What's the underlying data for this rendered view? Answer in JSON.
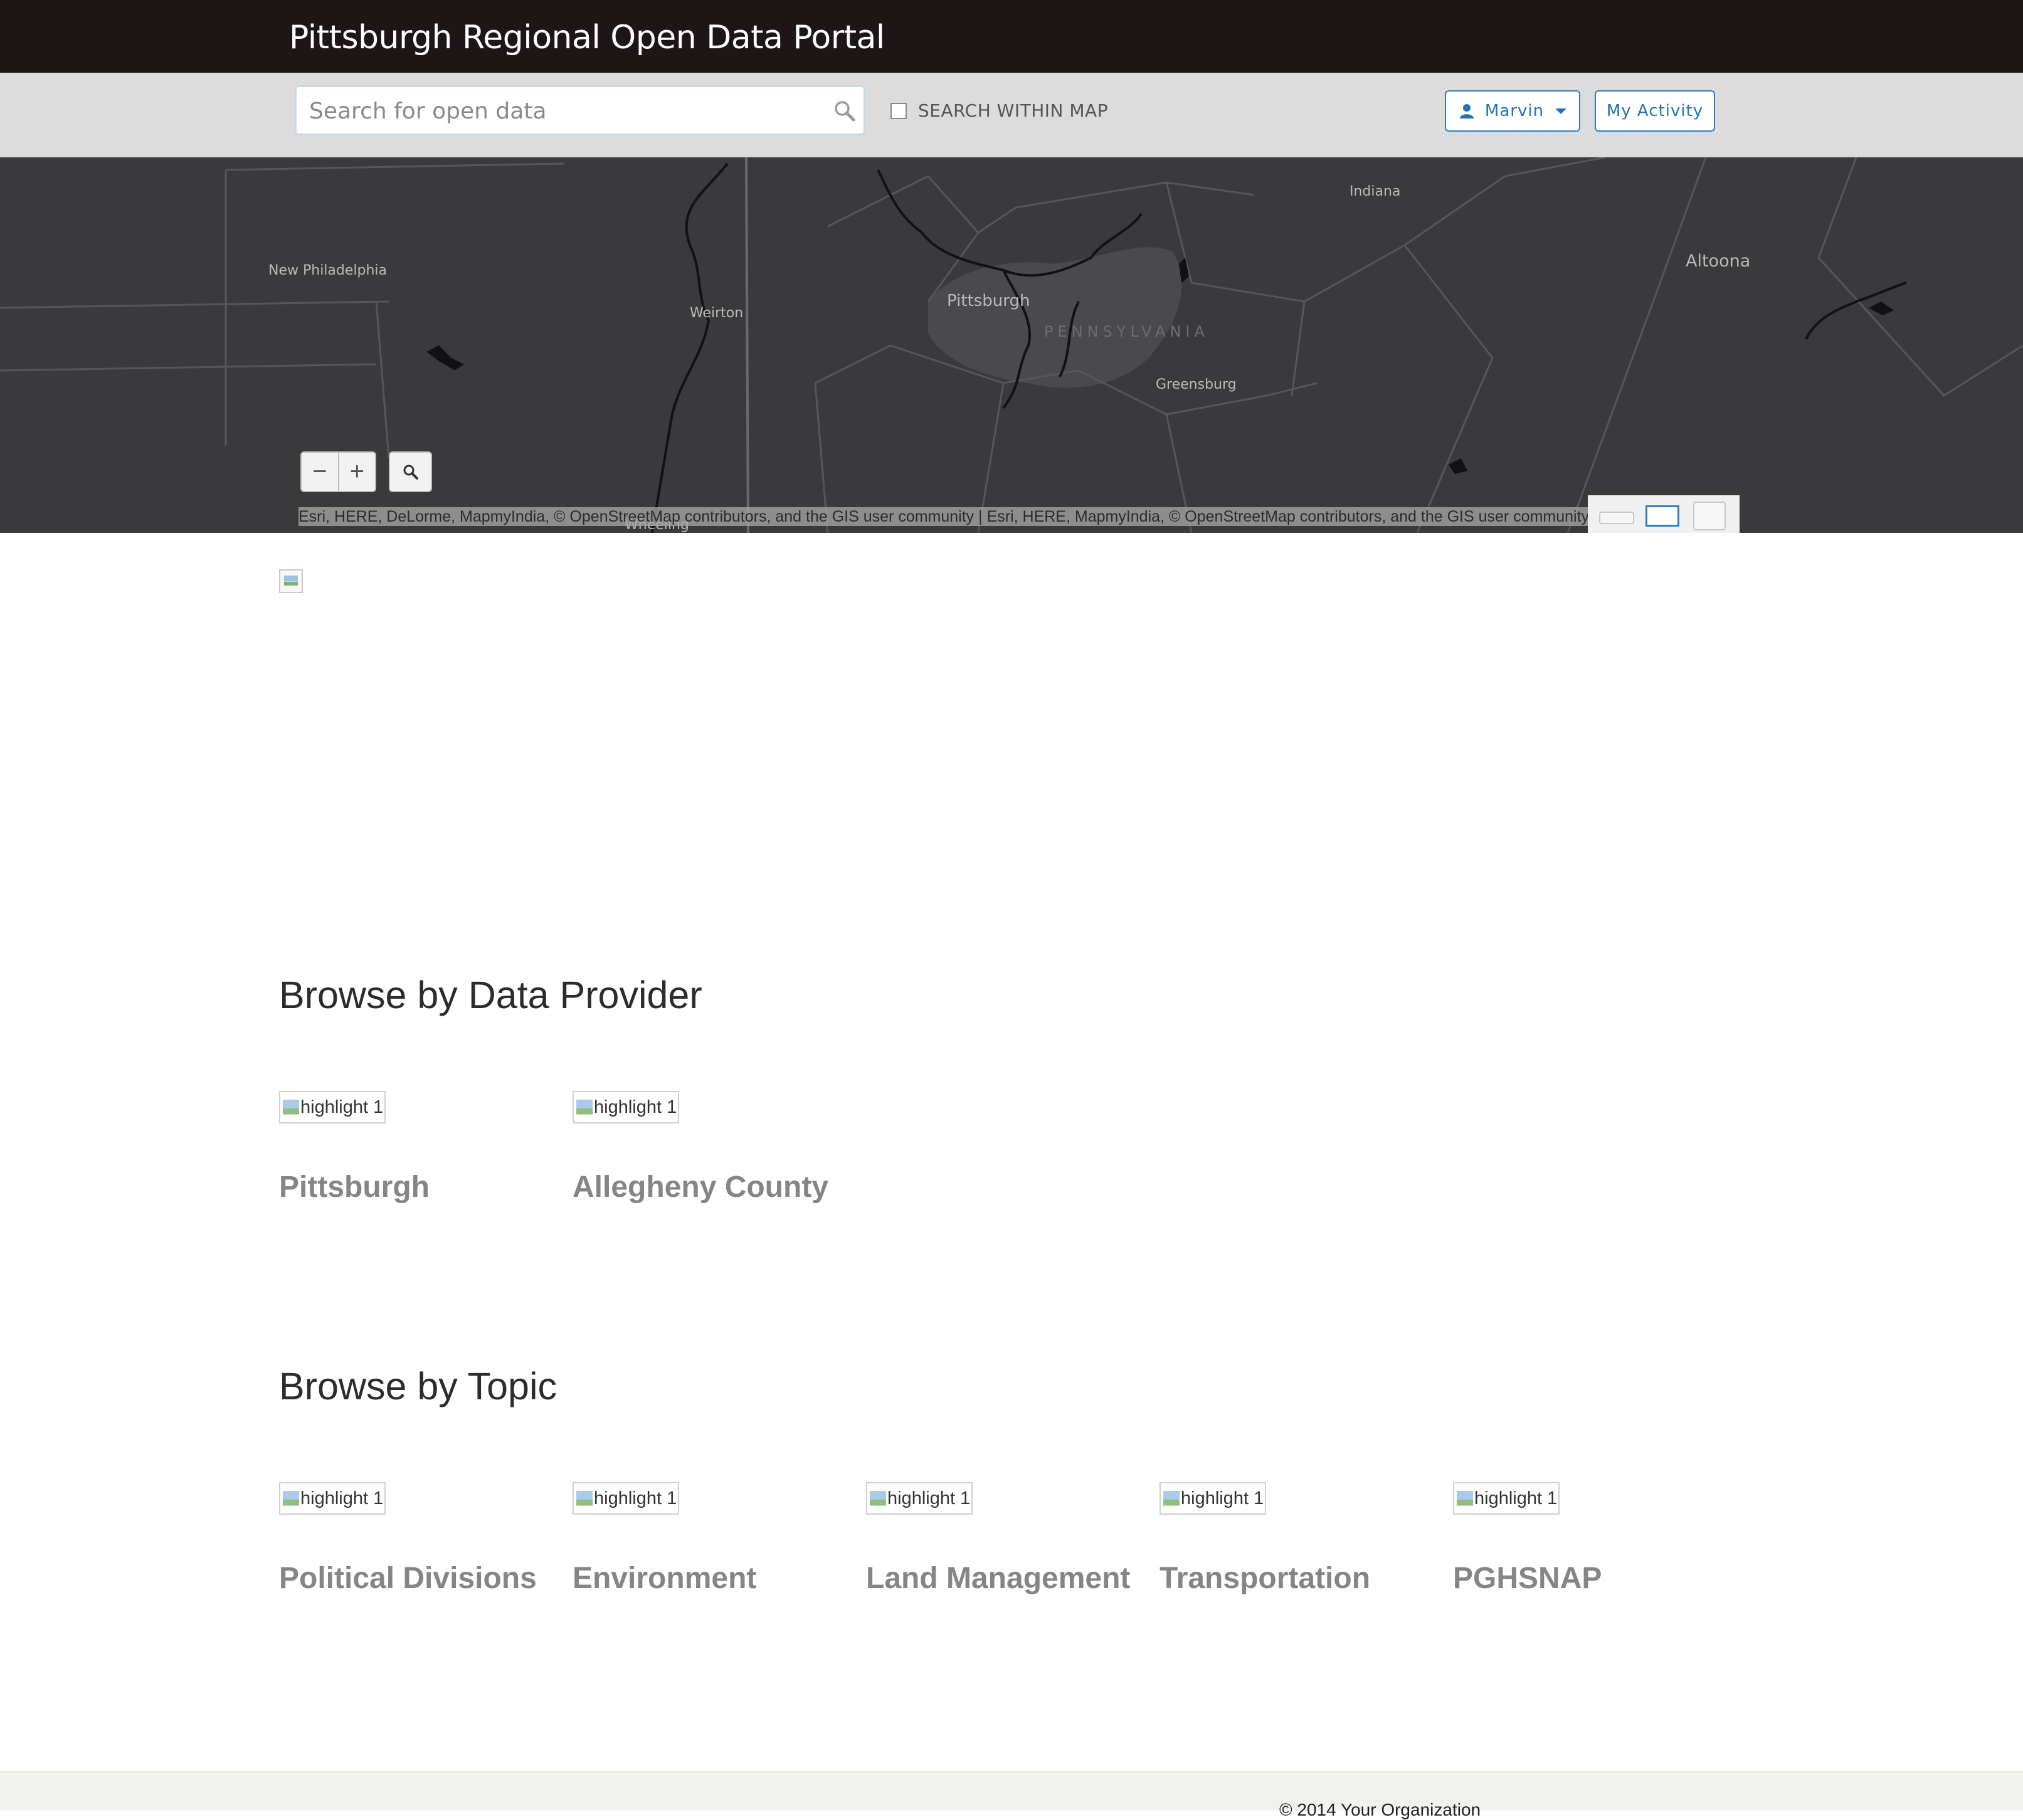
{
  "header": {
    "title": "Pittsburgh Regional Open Data Portal"
  },
  "search": {
    "placeholder": "Search for open data",
    "value": "",
    "within_map_label": "SEARCH WITHIN MAP",
    "within_map_checked": false
  },
  "user_menu": {
    "label": "Marvin"
  },
  "activity_button": {
    "label": "My Activity"
  },
  "map": {
    "labels": {
      "new_philadelphia": "New Philadelphia",
      "weirton": "Weirton",
      "pittsburgh": "Pittsburgh",
      "pennsylvania": "PENNSYLVANIA",
      "greensburg": "Greensburg",
      "indiana": "Indiana",
      "altoona": "Altoona",
      "wheeling": "Wheeling"
    },
    "zoom_out": "−",
    "zoom_in": "+",
    "attribution": "Esri, HERE, DeLorme, MapmyIndia, © OpenStreetMap contributors, and the GIS user community |  Esri, HERE, MapmyIndia, © OpenStreetMap contributors, and the GIS user community",
    "colors": {
      "land": "#3a3a3d",
      "boundary": "#58585c",
      "urban": "#4a4a4e",
      "water": "#111113"
    }
  },
  "providers": {
    "heading": "Browse by Data Provider",
    "items": [
      {
        "label": "Pittsburgh",
        "img_alt": "highlight 1"
      },
      {
        "label": "Allegheny County",
        "img_alt": "highlight 1"
      }
    ]
  },
  "topics": {
    "heading": "Browse by Topic",
    "items": [
      {
        "label": "Political Divisions",
        "img_alt": "highlight 1"
      },
      {
        "label": "Environment",
        "img_alt": "highlight 1"
      },
      {
        "label": "Land Management",
        "img_alt": "highlight 1"
      },
      {
        "label": "Transportation",
        "img_alt": "highlight 1"
      },
      {
        "label": "PGHSNAP",
        "img_alt": "highlight 1"
      }
    ]
  },
  "footer": {
    "copyright": "© 2014 Your Organization"
  },
  "colors": {
    "header_bg": "#1e1616",
    "accent": "#2573b4",
    "tile_label": "#858585"
  }
}
